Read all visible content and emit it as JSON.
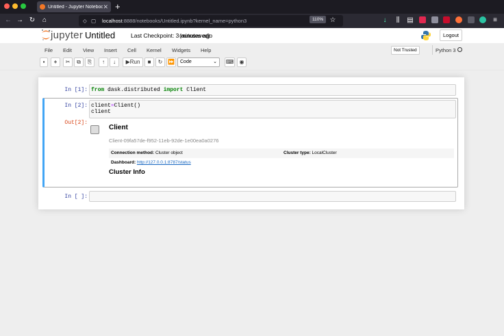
{
  "browser": {
    "tab_title": "Untitled - Jupyter Notebook",
    "tab_close": "✕",
    "new_tab": "+",
    "url_host": "localhost",
    "url_path": ":8888/notebooks/Untitled.ipynb?kernel_name=python3",
    "zoom": "110%"
  },
  "header": {
    "logo_text": "jupyter",
    "notebook_title": "Untitled",
    "checkpoint": "Last Checkpoint: 3 minutes ago",
    "autosaved": "(autosaved)",
    "logout": "Logout"
  },
  "menu": {
    "items": [
      "File",
      "Edit",
      "View",
      "Insert",
      "Cell",
      "Kernel",
      "Widgets",
      "Help"
    ],
    "not_trusted": "Not Trusted",
    "kernel_name": "Python 3"
  },
  "toolbar": {
    "run_label": "Run",
    "cell_type": "Code"
  },
  "cells": [
    {
      "prompt": "In [1]:",
      "code_kw1": "from",
      "code_mid": " dask.distributed ",
      "code_kw2": "import",
      "code_end": " Client"
    },
    {
      "prompt": "In [2]:",
      "line1_a": "client",
      "line1_op": "=",
      "line1_b": "Client()",
      "line2": "client",
      "out_prompt": "Out[2]:",
      "output": {
        "heading": "Client",
        "client_id": "Client-09fa57de-f952-11eb-92de-1e00ea0a0276",
        "conn_label": "Connection method:",
        "conn_value": " Cluster object",
        "ctype_label": "Cluster type:",
        "ctype_value": " LocalCluster",
        "dash_label": "Dashboard:",
        "dash_link": "http://127.0.0.1:8787/status",
        "cluster_info": "Cluster Info"
      }
    },
    {
      "prompt": "In [ ]:"
    }
  ]
}
